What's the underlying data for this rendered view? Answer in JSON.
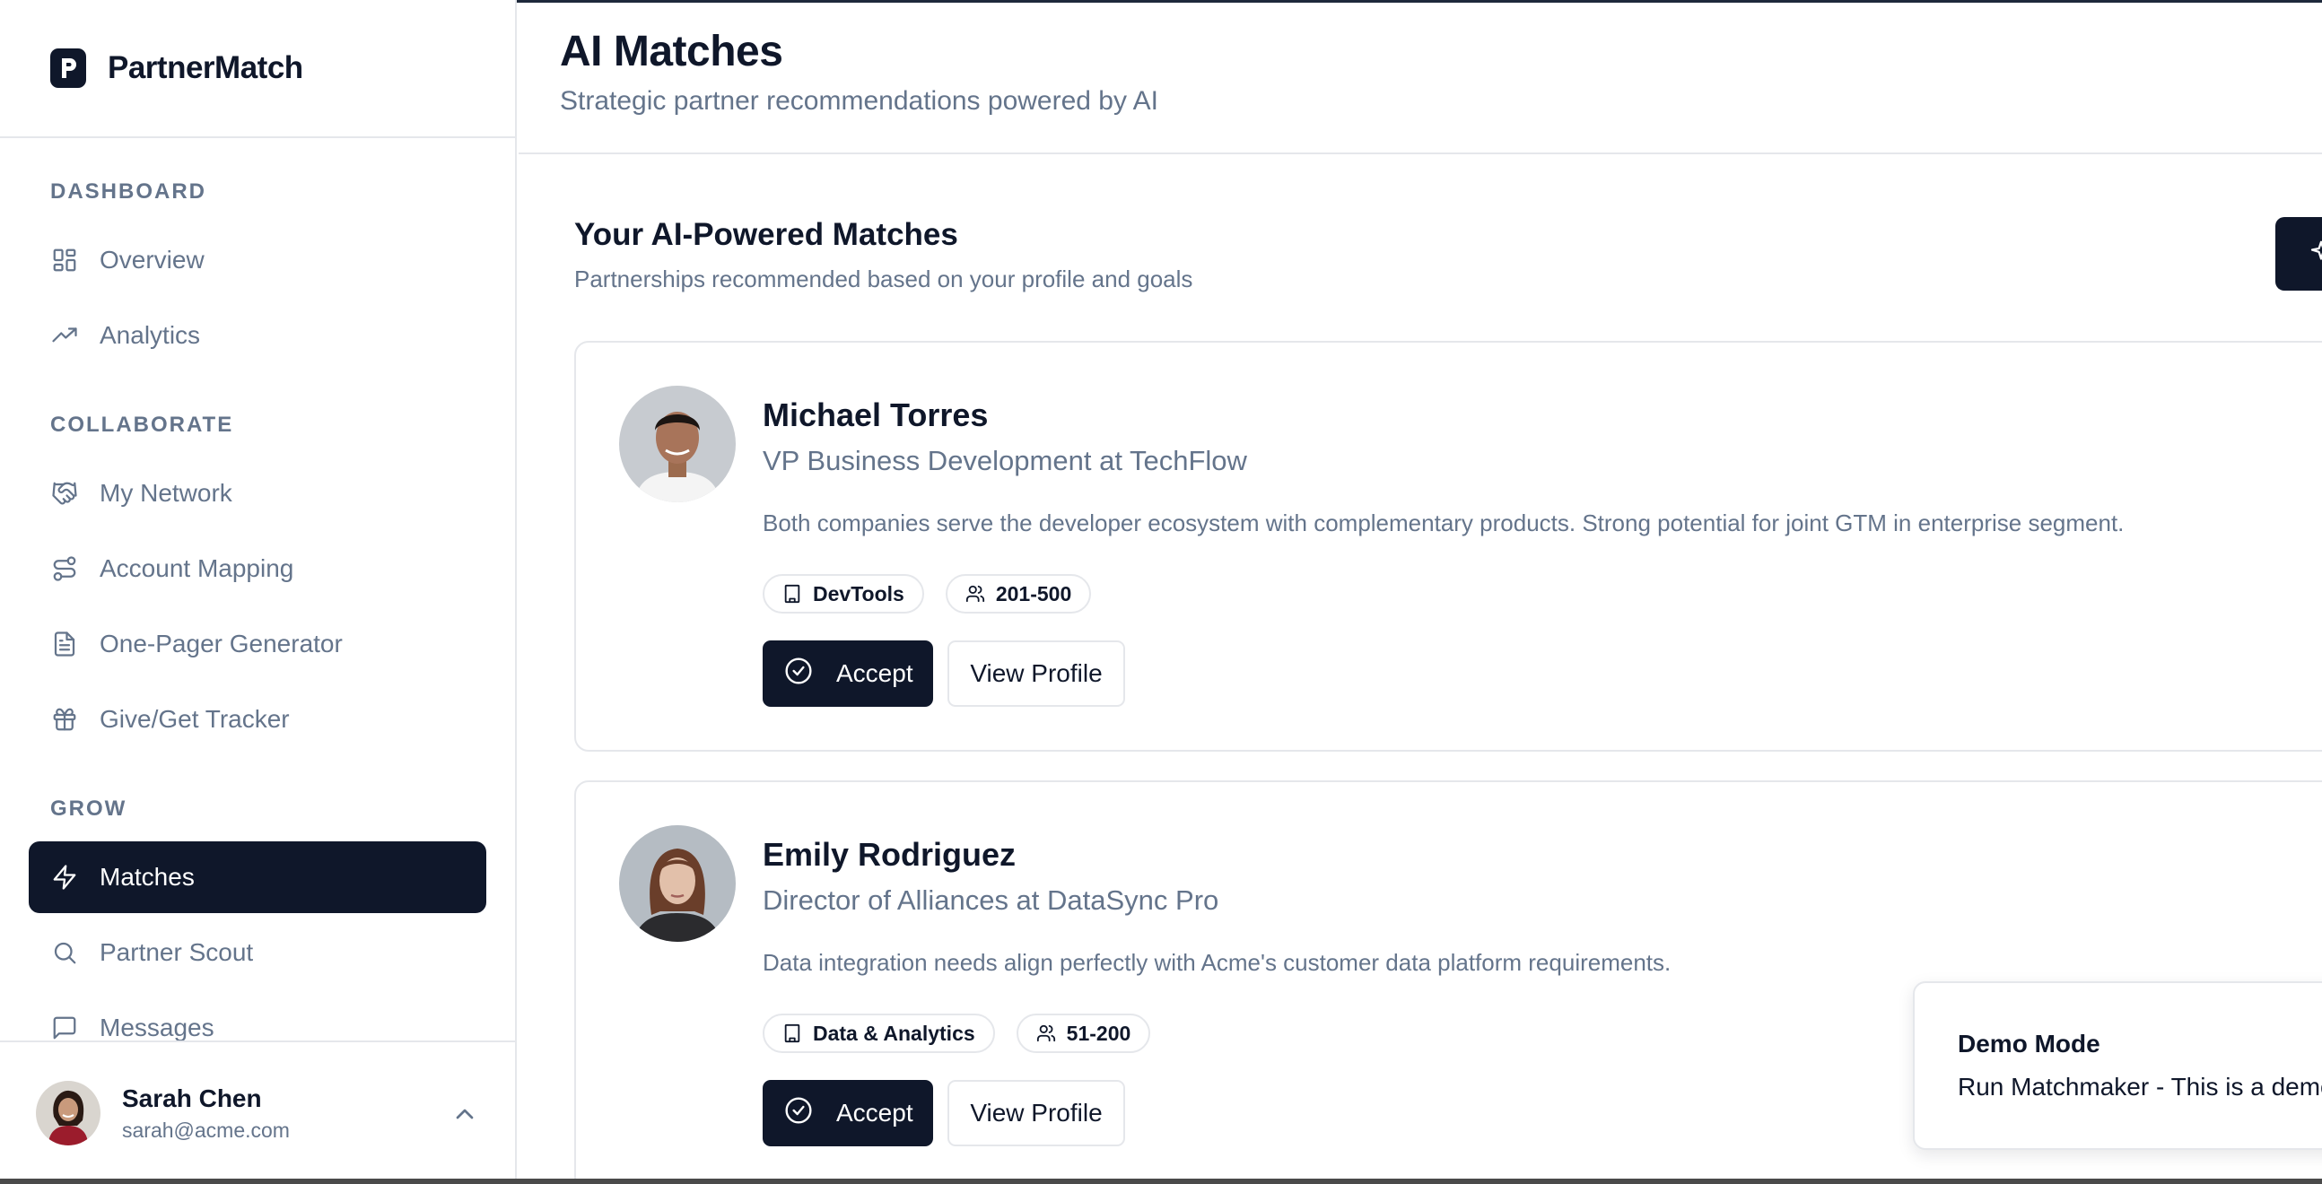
{
  "app": {
    "name": "PartnerMatch"
  },
  "sidebar": {
    "sections": [
      {
        "label": "DASHBOARD",
        "items": [
          {
            "label": "Overview",
            "icon": "grid-icon"
          },
          {
            "label": "Analytics",
            "icon": "trending-up-icon"
          }
        ]
      },
      {
        "label": "COLLABORATE",
        "items": [
          {
            "label": "My Network",
            "icon": "handshake-icon"
          },
          {
            "label": "Account Mapping",
            "icon": "route-icon"
          },
          {
            "label": "One-Pager Generator",
            "icon": "file-text-icon"
          },
          {
            "label": "Give/Get Tracker",
            "icon": "gift-icon"
          }
        ]
      },
      {
        "label": "GROW",
        "items": [
          {
            "label": "Matches",
            "icon": "zap-icon",
            "active": true
          },
          {
            "label": "Partner Scout",
            "icon": "search-icon"
          },
          {
            "label": "Messages",
            "icon": "message-square-icon"
          }
        ]
      }
    ],
    "user": {
      "name": "Sarah Chen",
      "email": "sarah@acme.com"
    }
  },
  "header": {
    "title": "AI Matches",
    "subtitle": "Strategic partner recommendations powered by AI"
  },
  "matches_section": {
    "title": "Your AI-Powered Matches",
    "subtitle": "Partnerships recommended based on your profile and goals"
  },
  "matches": [
    {
      "name": "Michael Torres",
      "role": "VP Business Development at TechFlow",
      "reason": "Both companies serve the developer ecosystem with complementary products. Strong potential for joint GTM in enterprise segment.",
      "industry": "DevTools",
      "size": "201-500",
      "accept_label": "Accept",
      "view_label": "View Profile"
    },
    {
      "name": "Emily Rodriguez",
      "role": "Director of Alliances at DataSync Pro",
      "reason": "Data integration needs align perfectly with Acme's customer data platform requirements.",
      "industry": "Data & Analytics",
      "size": "51-200",
      "accept_label": "Accept",
      "view_label": "View Profile"
    }
  ],
  "toast": {
    "title": "Demo Mode",
    "message": "Run Matchmaker - This is a demo"
  },
  "colors": {
    "primary": "#0f172a",
    "muted": "#64748b",
    "border": "#e5e7eb"
  }
}
